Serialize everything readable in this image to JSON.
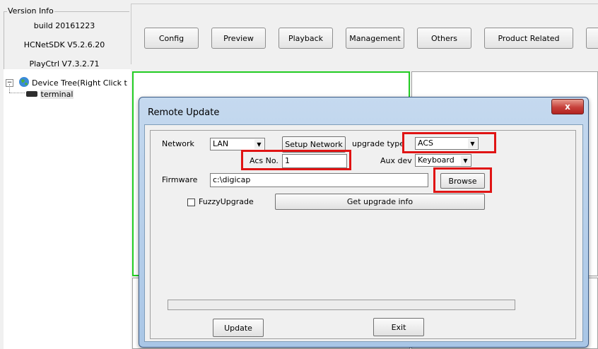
{
  "version_info": {
    "title": "Version Info",
    "build": "build 20161223",
    "sdk": "HCNetSDK V5.2.6.20",
    "playctrl": "PlayCtrl V7.3.2.71"
  },
  "toolbar": {
    "buttons": [
      "Config",
      "Preview",
      "Playback",
      "Management",
      "Others",
      "Product Related"
    ]
  },
  "tree": {
    "root_label": "Device Tree(Right Click t",
    "child_label": "terminal"
  },
  "dialog": {
    "title": "Remote Update",
    "close_label": "x",
    "network_label": "Network",
    "network_value": "LAN",
    "setup_network": "Setup Network",
    "upgrade_type_label": "upgrade type",
    "upgrade_type_value": "ACS",
    "acs_no_label": "Acs No.",
    "acs_no_value": "1",
    "aux_dev_label": "Aux dev",
    "aux_dev_value": "Keyboard",
    "firmware_label": "Firmware",
    "firmware_value": "c:\\digicap",
    "browse": "Browse",
    "fuzzy_upgrade": "FuzzyUpgrade",
    "fuzzy_checked": false,
    "get_upgrade_info": "Get upgrade info",
    "update": "Update",
    "exit": "Exit",
    "progress": 0
  },
  "colors": {
    "highlight_red": "#e01414",
    "selected_pane_green": "#22cc22"
  }
}
